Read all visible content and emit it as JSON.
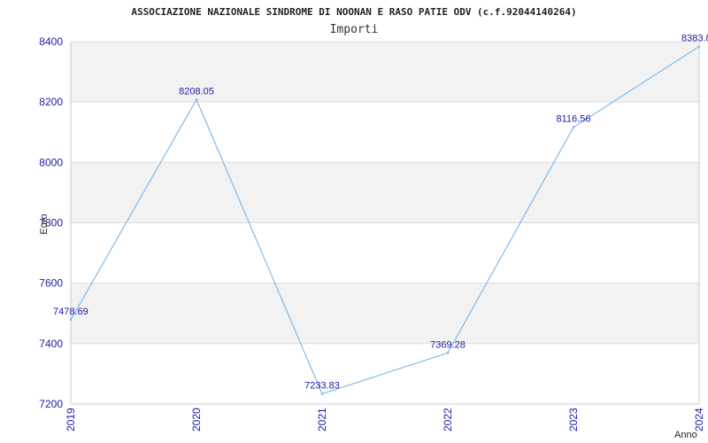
{
  "chart_data": {
    "type": "line",
    "title": "ASSOCIAZIONE NAZIONALE SINDROME DI NOONAN E RASO PATIE ODV (c.f.92044140264)",
    "subtitle": "Importi",
    "xlabel": "Anno",
    "ylabel": "Euro",
    "categories": [
      "2019",
      "2020",
      "2021",
      "2022",
      "2023",
      "2024"
    ],
    "series": [
      {
        "values": [
          7478.69,
          8208.05,
          7233.83,
          7369.28,
          8116.56,
          8383.8
        ],
        "labels": [
          "7478.69",
          "8208.05",
          "7233.83",
          "7369.28",
          "8116.56",
          "8383.8"
        ]
      }
    ],
    "ylim": [
      7200,
      8400
    ],
    "yticks": [
      7200,
      7400,
      7600,
      7800,
      8000,
      8200,
      8400
    ],
    "grid": true,
    "colors": {
      "line": "#6aaee8",
      "tick_text": "#1a1aa6",
      "band": "#f2f2f2",
      "grid": "#dddddd",
      "axis": "#cccccc"
    }
  }
}
